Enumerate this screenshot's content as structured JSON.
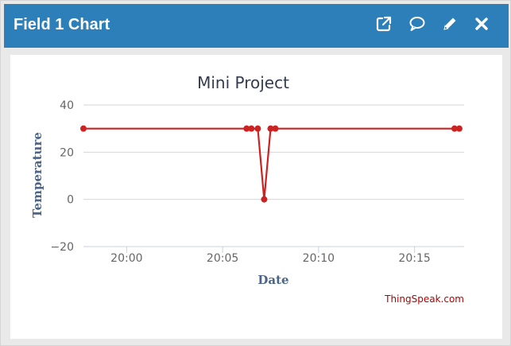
{
  "window": {
    "title": "Field 1 Chart",
    "icons": [
      "external-link-icon",
      "comment-icon",
      "pencil-icon",
      "close-icon"
    ]
  },
  "colors": {
    "header": "#2c7fb8",
    "series": "#cc2222",
    "axis_title": "#4a6587",
    "credit": "#b40000"
  },
  "credit": "ThingSpeak.com",
  "chart_data": {
    "type": "line",
    "title": "Mini Project",
    "xlabel": "Date",
    "ylabel": "Temperature",
    "ylim": [
      -20,
      40
    ],
    "yticks": [
      40,
      20,
      0,
      -20
    ],
    "ytick_labels": [
      "40",
      "20",
      "0",
      "−20"
    ],
    "xlim": [
      "19:57:45",
      "20:17:35"
    ],
    "xticks": [
      "20:00",
      "20:05",
      "20:10",
      "20:15"
    ],
    "grid": true,
    "series": [
      {
        "x": [
          "19:57:45",
          "20:06:15",
          "20:06:30",
          "20:06:50",
          "20:07:10",
          "20:07:30",
          "20:07:45",
          "20:17:05",
          "20:17:20"
        ],
        "y": [
          30,
          30,
          30,
          30,
          0,
          30,
          30,
          30,
          30
        ]
      }
    ]
  }
}
